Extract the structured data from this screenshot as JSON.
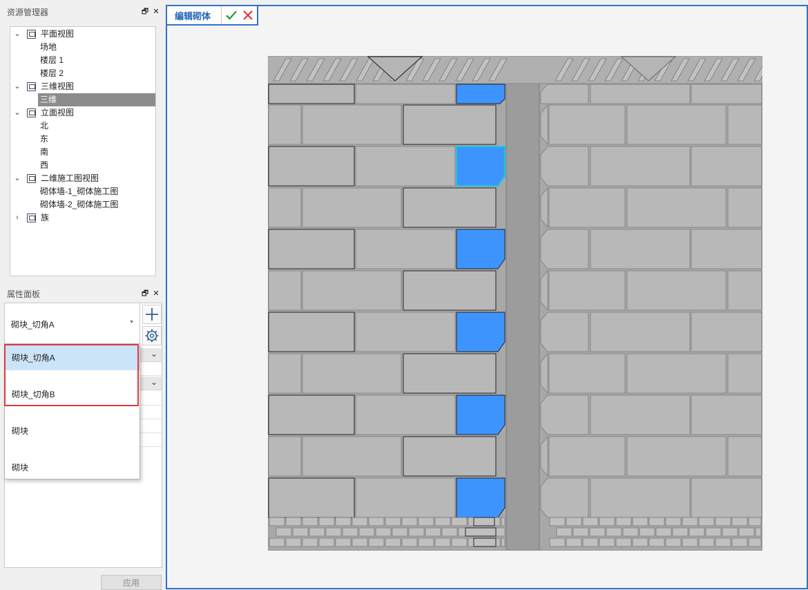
{
  "resource_panel": {
    "title": "资源管理器",
    "tree": [
      {
        "label": "平面视图",
        "level": 0,
        "expanded": true,
        "icon": "plan-view-icon"
      },
      {
        "label": "场地",
        "level": 1
      },
      {
        "label": "楼层 1",
        "level": 1
      },
      {
        "label": "楼层 2",
        "level": 1
      },
      {
        "label": "三维视图",
        "level": 0,
        "expanded": true,
        "icon": "3d-view-icon"
      },
      {
        "label": "三维",
        "level": 1,
        "selected": true
      },
      {
        "label": "立面视图",
        "level": 0,
        "expanded": true,
        "icon": "elevation-view-icon"
      },
      {
        "label": "北",
        "level": 1
      },
      {
        "label": "东",
        "level": 1
      },
      {
        "label": "南",
        "level": 1
      },
      {
        "label": "西",
        "level": 1
      },
      {
        "label": "二维施工图视图",
        "level": 0,
        "expanded": true,
        "icon": "2d-drawing-view-icon"
      },
      {
        "label": "砌体墙-1_砌体施工图",
        "level": 1
      },
      {
        "label": "砌体墙-2_砌体施工图",
        "level": 1
      },
      {
        "label": "族",
        "level": 0,
        "expanded": false,
        "icon": "family-icon"
      }
    ]
  },
  "property_panel": {
    "title": "属性面板",
    "selected_type": "砌块_切角A",
    "dropdown_options": [
      "砌块_切角A",
      "砌块_切角B",
      "砌块",
      "砌块"
    ],
    "highlighted_option": "砌块_切角A",
    "apply_label": "应用"
  },
  "editor": {
    "tab_title": "编辑砌体",
    "confirm_color": "#2a9d3a",
    "cancel_color": "#e0383e",
    "highlight_color": "#3d94ff",
    "block_color": "#b8b8b8",
    "mortar_color": "#9a9a9a"
  }
}
